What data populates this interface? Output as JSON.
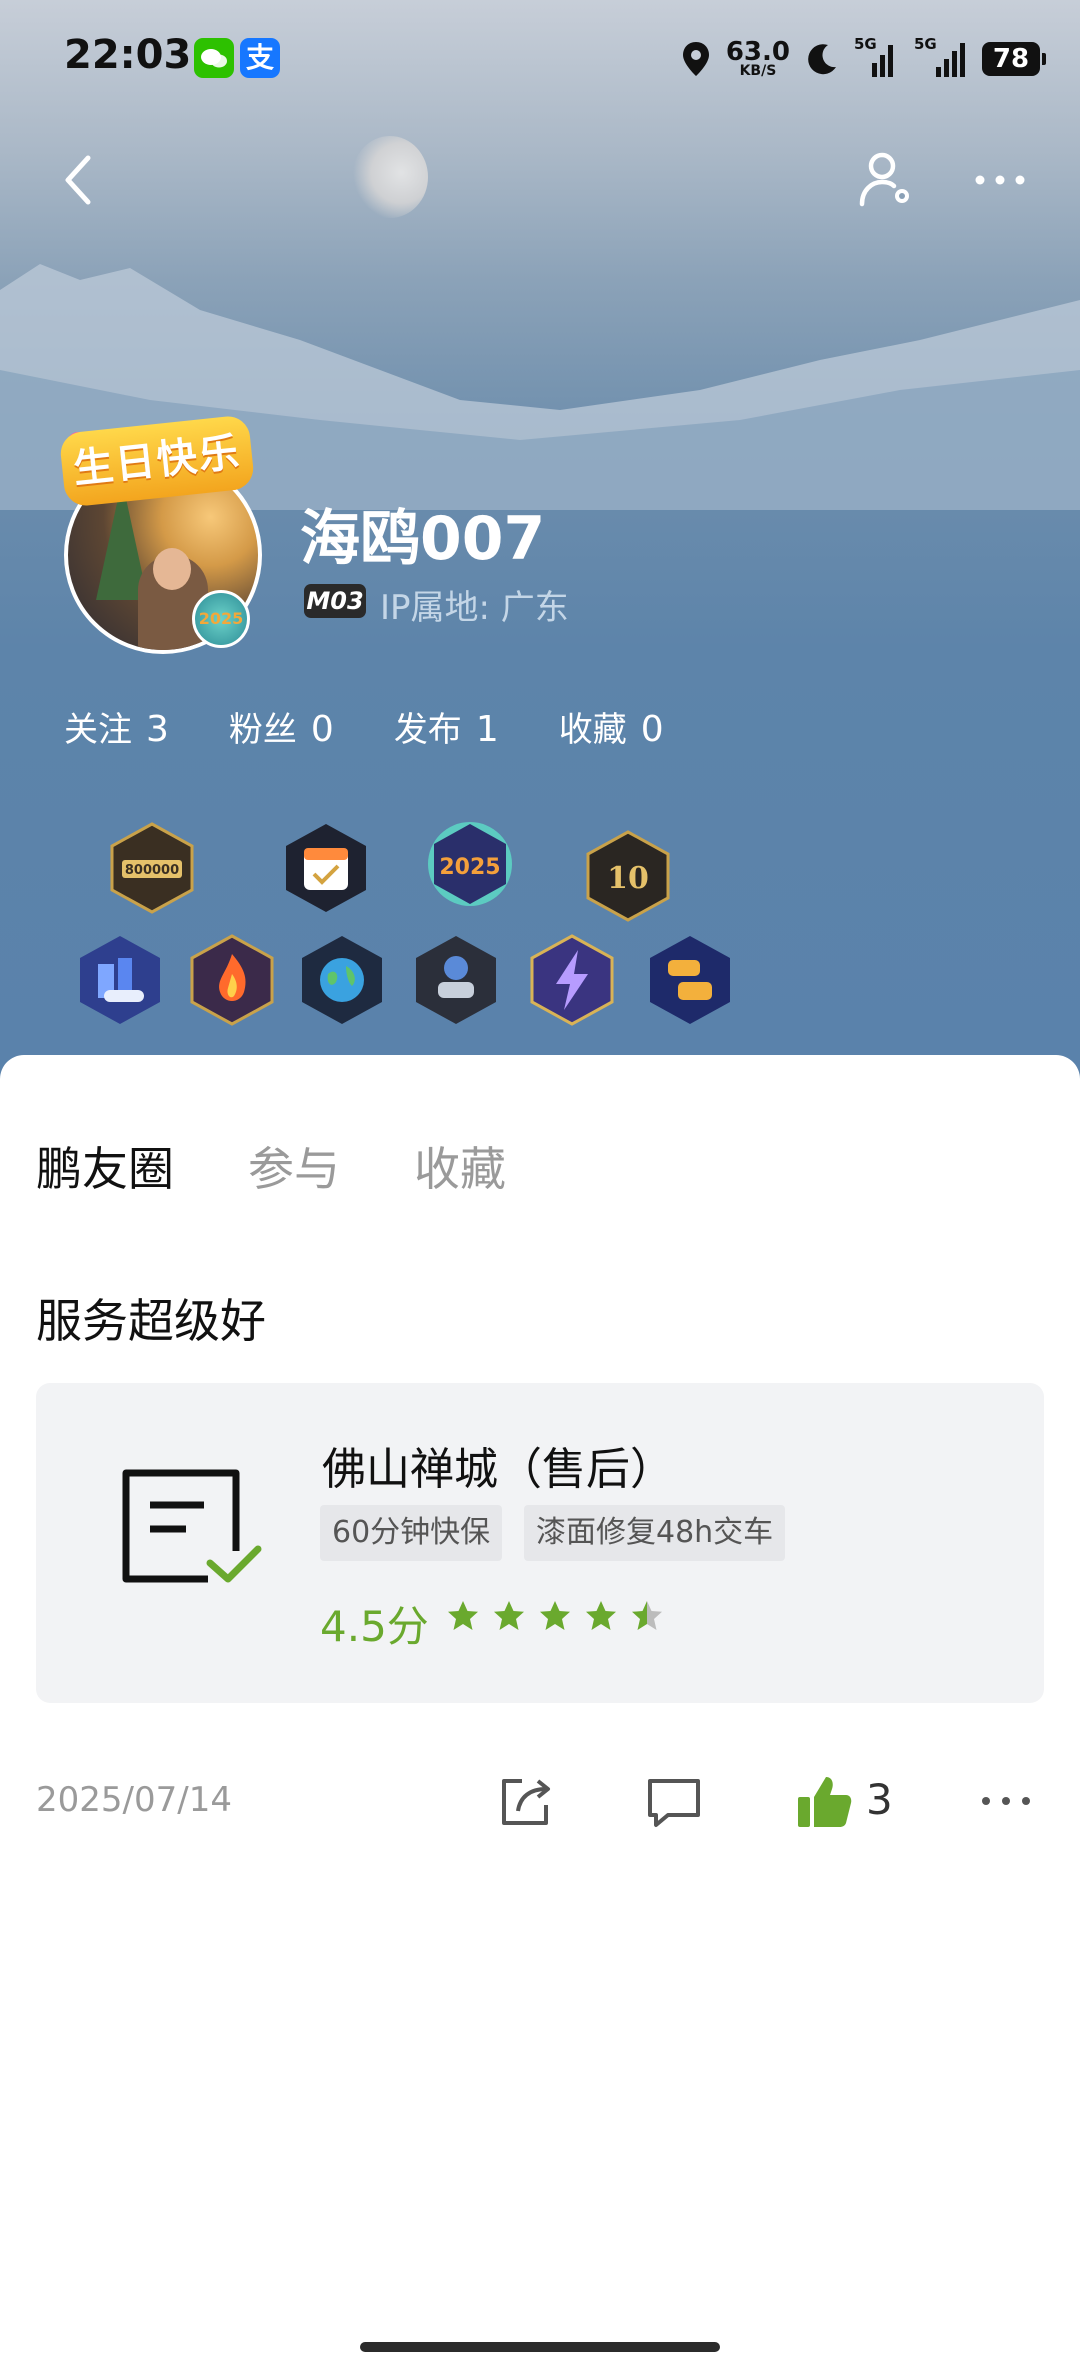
{
  "status_bar": {
    "time": "22:03",
    "alipay_glyph": "支",
    "net_speed": "63.0",
    "net_unit": "KB/S",
    "sim1": "5G",
    "sim2": "5G",
    "battery": "78"
  },
  "nav": {
    "back_icon": "chevron-left-icon",
    "user_settings_icon": "user-gear-icon",
    "more_icon": "more-horizontal-icon"
  },
  "profile": {
    "birthday_badge": "生日快乐",
    "avatar_badge": "2025",
    "username": "海鸥007",
    "model_badge": "M03",
    "ip_location": "IP属地: 广东",
    "stats": [
      {
        "label": "关注",
        "value": "3"
      },
      {
        "label": "粉丝",
        "value": "0"
      },
      {
        "label": "发布",
        "value": "1"
      },
      {
        "label": "收藏",
        "value": "0"
      }
    ],
    "medals": {
      "m1_text": "800000",
      "m3_text": "2025",
      "m4_text": "10"
    }
  },
  "tabs": [
    {
      "label": "鹏友圈",
      "active": true
    },
    {
      "label": "参与",
      "active": false
    },
    {
      "label": "收藏",
      "active": false
    }
  ],
  "post": {
    "title": "服务超级好",
    "card": {
      "name": "佛山禅城（售后）",
      "tags": [
        "60分钟快保",
        "漆面修复48h交车"
      ],
      "score": "4.5分",
      "rating": 4.5,
      "rating_max": 5
    },
    "date": "2025/07/14",
    "likes": "3"
  },
  "colors": {
    "accent_green": "#6aa92e",
    "hero_blue": "#5a82ab"
  }
}
